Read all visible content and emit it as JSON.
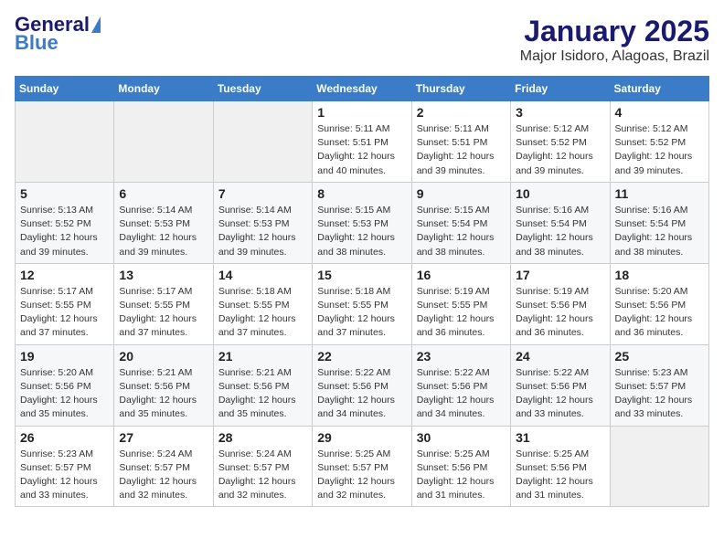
{
  "logo": {
    "part1": "General",
    "part2": "Blue"
  },
  "title": "January 2025",
  "subtitle": "Major Isidoro, Alagoas, Brazil",
  "weekdays": [
    "Sunday",
    "Monday",
    "Tuesday",
    "Wednesday",
    "Thursday",
    "Friday",
    "Saturday"
  ],
  "weeks": [
    [
      {
        "num": "",
        "info": ""
      },
      {
        "num": "",
        "info": ""
      },
      {
        "num": "",
        "info": ""
      },
      {
        "num": "1",
        "info": "Sunrise: 5:11 AM\nSunset: 5:51 PM\nDaylight: 12 hours\nand 40 minutes."
      },
      {
        "num": "2",
        "info": "Sunrise: 5:11 AM\nSunset: 5:51 PM\nDaylight: 12 hours\nand 39 minutes."
      },
      {
        "num": "3",
        "info": "Sunrise: 5:12 AM\nSunset: 5:52 PM\nDaylight: 12 hours\nand 39 minutes."
      },
      {
        "num": "4",
        "info": "Sunrise: 5:12 AM\nSunset: 5:52 PM\nDaylight: 12 hours\nand 39 minutes."
      }
    ],
    [
      {
        "num": "5",
        "info": "Sunrise: 5:13 AM\nSunset: 5:52 PM\nDaylight: 12 hours\nand 39 minutes."
      },
      {
        "num": "6",
        "info": "Sunrise: 5:14 AM\nSunset: 5:53 PM\nDaylight: 12 hours\nand 39 minutes."
      },
      {
        "num": "7",
        "info": "Sunrise: 5:14 AM\nSunset: 5:53 PM\nDaylight: 12 hours\nand 39 minutes."
      },
      {
        "num": "8",
        "info": "Sunrise: 5:15 AM\nSunset: 5:53 PM\nDaylight: 12 hours\nand 38 minutes."
      },
      {
        "num": "9",
        "info": "Sunrise: 5:15 AM\nSunset: 5:54 PM\nDaylight: 12 hours\nand 38 minutes."
      },
      {
        "num": "10",
        "info": "Sunrise: 5:16 AM\nSunset: 5:54 PM\nDaylight: 12 hours\nand 38 minutes."
      },
      {
        "num": "11",
        "info": "Sunrise: 5:16 AM\nSunset: 5:54 PM\nDaylight: 12 hours\nand 38 minutes."
      }
    ],
    [
      {
        "num": "12",
        "info": "Sunrise: 5:17 AM\nSunset: 5:55 PM\nDaylight: 12 hours\nand 37 minutes."
      },
      {
        "num": "13",
        "info": "Sunrise: 5:17 AM\nSunset: 5:55 PM\nDaylight: 12 hours\nand 37 minutes."
      },
      {
        "num": "14",
        "info": "Sunrise: 5:18 AM\nSunset: 5:55 PM\nDaylight: 12 hours\nand 37 minutes."
      },
      {
        "num": "15",
        "info": "Sunrise: 5:18 AM\nSunset: 5:55 PM\nDaylight: 12 hours\nand 37 minutes."
      },
      {
        "num": "16",
        "info": "Sunrise: 5:19 AM\nSunset: 5:55 PM\nDaylight: 12 hours\nand 36 minutes."
      },
      {
        "num": "17",
        "info": "Sunrise: 5:19 AM\nSunset: 5:56 PM\nDaylight: 12 hours\nand 36 minutes."
      },
      {
        "num": "18",
        "info": "Sunrise: 5:20 AM\nSunset: 5:56 PM\nDaylight: 12 hours\nand 36 minutes."
      }
    ],
    [
      {
        "num": "19",
        "info": "Sunrise: 5:20 AM\nSunset: 5:56 PM\nDaylight: 12 hours\nand 35 minutes."
      },
      {
        "num": "20",
        "info": "Sunrise: 5:21 AM\nSunset: 5:56 PM\nDaylight: 12 hours\nand 35 minutes."
      },
      {
        "num": "21",
        "info": "Sunrise: 5:21 AM\nSunset: 5:56 PM\nDaylight: 12 hours\nand 35 minutes."
      },
      {
        "num": "22",
        "info": "Sunrise: 5:22 AM\nSunset: 5:56 PM\nDaylight: 12 hours\nand 34 minutes."
      },
      {
        "num": "23",
        "info": "Sunrise: 5:22 AM\nSunset: 5:56 PM\nDaylight: 12 hours\nand 34 minutes."
      },
      {
        "num": "24",
        "info": "Sunrise: 5:22 AM\nSunset: 5:56 PM\nDaylight: 12 hours\nand 33 minutes."
      },
      {
        "num": "25",
        "info": "Sunrise: 5:23 AM\nSunset: 5:57 PM\nDaylight: 12 hours\nand 33 minutes."
      }
    ],
    [
      {
        "num": "26",
        "info": "Sunrise: 5:23 AM\nSunset: 5:57 PM\nDaylight: 12 hours\nand 33 minutes."
      },
      {
        "num": "27",
        "info": "Sunrise: 5:24 AM\nSunset: 5:57 PM\nDaylight: 12 hours\nand 32 minutes."
      },
      {
        "num": "28",
        "info": "Sunrise: 5:24 AM\nSunset: 5:57 PM\nDaylight: 12 hours\nand 32 minutes."
      },
      {
        "num": "29",
        "info": "Sunrise: 5:25 AM\nSunset: 5:57 PM\nDaylight: 12 hours\nand 32 minutes."
      },
      {
        "num": "30",
        "info": "Sunrise: 5:25 AM\nSunset: 5:56 PM\nDaylight: 12 hours\nand 31 minutes."
      },
      {
        "num": "31",
        "info": "Sunrise: 5:25 AM\nSunset: 5:56 PM\nDaylight: 12 hours\nand 31 minutes."
      },
      {
        "num": "",
        "info": ""
      }
    ]
  ]
}
